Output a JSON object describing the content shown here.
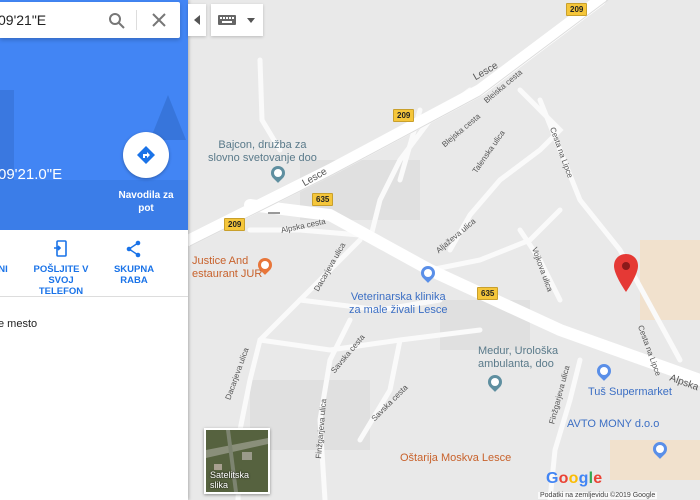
{
  "search": {
    "value": "09'21\"E"
  },
  "panel": {
    "coords": "09'21.0\"E",
    "directions_label": "Navodila za pot",
    "actions": [
      {
        "label": "NI"
      },
      {
        "label": "POŠLJITE V SVOJ TELEFON"
      },
      {
        "label": "SKUPNA RABA"
      }
    ],
    "place_note": "e mesto"
  },
  "map": {
    "roads": [
      {
        "label": "Lesce"
      },
      {
        "label": "Lesce"
      },
      {
        "label": "Bleiska cesta"
      },
      {
        "label": "Blejska cesta"
      },
      {
        "label": "Talenska ulica"
      },
      {
        "label": "Cesta na Lipce"
      },
      {
        "label": "Cesta na Lipce"
      },
      {
        "label": "Alpska cesta"
      },
      {
        "label": "Alpska c"
      },
      {
        "label": "Aljaževa ulica"
      },
      {
        "label": "Vojkova ulica"
      },
      {
        "label": "Dacarjeva ulica"
      },
      {
        "label": "Dacarjeva ulica"
      },
      {
        "label": "Savska cesta"
      },
      {
        "label": "Savska cesta"
      },
      {
        "label": "Finžgarjeva ulica"
      },
      {
        "label": "Finžgarjeva ulica"
      }
    ],
    "shields": [
      "209",
      "209",
      "209",
      "635",
      "635"
    ],
    "pois": [
      {
        "name": "Bajcon, družba za\nslovno svetovanje doo",
        "color": "#5f8fa0"
      },
      {
        "name": "Justice And\nestaurant JUR",
        "color": "#e8763a"
      },
      {
        "name": "Veterinarska klinika\nza male živali Lesce",
        "color": "#5a8fe8"
      },
      {
        "name": "Medur, Urološka\nambulanta, doo",
        "color": "#5f8fa0"
      },
      {
        "name": "Tuš Supermarket",
        "color": "#5a8fe8"
      },
      {
        "name": "AVTO MONY d.o.o",
        "color": "#5a8fe8"
      },
      {
        "name": "Oštarija Moskva Lesce",
        "color": "#e8763a"
      }
    ],
    "marker_color": "#e53935"
  },
  "satellite": {
    "label": "Satelitska slika"
  },
  "footer": {
    "logo": "Google",
    "copyright": "Podatki na zemljevidu ©2019 Google"
  }
}
